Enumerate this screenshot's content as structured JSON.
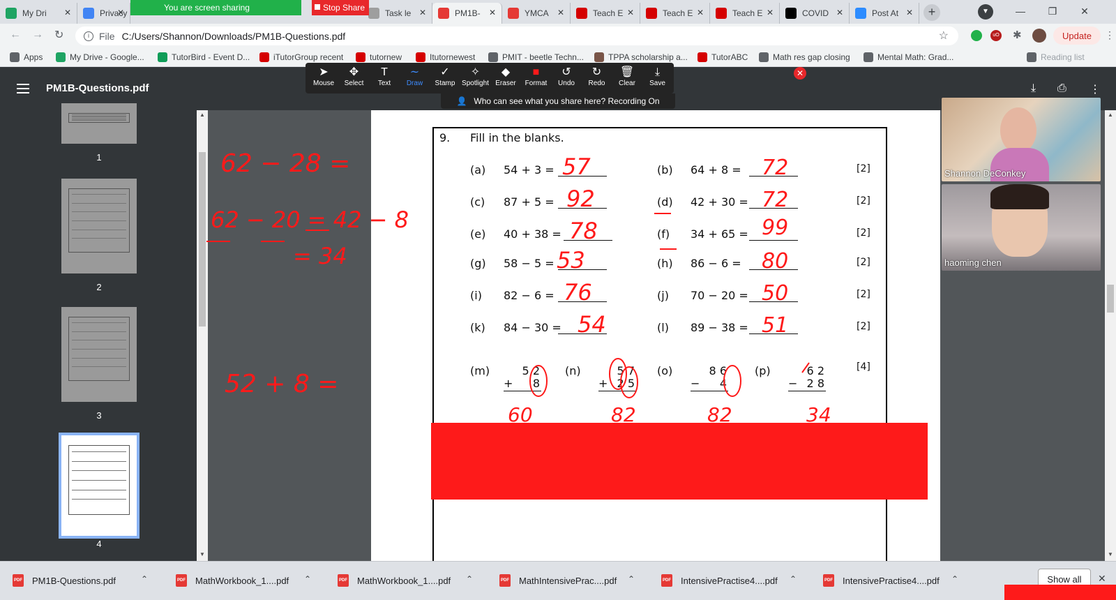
{
  "tabs": [
    {
      "label": "My Dri",
      "icon": "google-drive-icon",
      "color": "#1fa463"
    },
    {
      "label": "Privacy",
      "icon": "google-icon",
      "color": "#4285f4"
    },
    {
      "label": "Task le",
      "icon": "document-icon",
      "color": "#9e9e9e"
    },
    {
      "label": "PM1B-",
      "icon": "pdf-icon",
      "color": "#e53935",
      "active": true
    },
    {
      "label": "YMCA",
      "icon": "ymca-icon",
      "color": "#e53935"
    },
    {
      "label": "Teach E",
      "icon": "itutor-icon",
      "color": "#d50000"
    },
    {
      "label": "Teach E",
      "icon": "itutor-icon",
      "color": "#d50000"
    },
    {
      "label": "Teach E",
      "icon": "itutor-icon",
      "color": "#d50000"
    },
    {
      "label": "COVID",
      "icon": "covid-icon",
      "color": "#000000"
    },
    {
      "label": "Post At",
      "icon": "zoom-icon",
      "color": "#2d8cff"
    }
  ],
  "sharing": {
    "status": "You are screen sharing",
    "stop_label": "Stop Share"
  },
  "address": {
    "prefix": "File",
    "url": "C:/Users/Shannon/Downloads/PM1B-Questions.pdf",
    "update_label": "Update"
  },
  "bookmarks": [
    {
      "label": "Apps",
      "color": "#5f6368"
    },
    {
      "label": "My Drive - Google...",
      "color": "#1fa463"
    },
    {
      "label": "TutorBird - Event D...",
      "color": "#0f9d58"
    },
    {
      "label": "iTutorGroup recent",
      "color": "#d50000"
    },
    {
      "label": "tutornew",
      "color": "#d50000"
    },
    {
      "label": "Itutornewest",
      "color": "#d50000"
    },
    {
      "label": "PMIT - beetle Techn...",
      "color": "#5f6368"
    },
    {
      "label": "TPPA scholarship a...",
      "color": "#795548"
    },
    {
      "label": "TutorABC",
      "color": "#d50000"
    },
    {
      "label": "Math res gap closing",
      "color": "#5f6368"
    },
    {
      "label": "Mental Math: Grad...",
      "color": "#5f6368"
    },
    {
      "label": "Reading list",
      "color": "#5f6368"
    }
  ],
  "pdf": {
    "title": "PM1B-Questions.pdf"
  },
  "annotate_tools": [
    {
      "label": "Mouse",
      "icon": "cursor-icon",
      "glyph": "➤"
    },
    {
      "label": "Select",
      "icon": "move-icon",
      "glyph": "✥"
    },
    {
      "label": "Text",
      "icon": "text-icon",
      "glyph": "T"
    },
    {
      "label": "Draw",
      "icon": "draw-icon",
      "glyph": "∼",
      "selected": true
    },
    {
      "label": "Stamp",
      "icon": "stamp-icon",
      "glyph": "✓"
    },
    {
      "label": "Spotlight",
      "icon": "spotlight-icon",
      "glyph": "✧"
    },
    {
      "label": "Eraser",
      "icon": "eraser-icon",
      "glyph": "◆"
    },
    {
      "label": "Format",
      "icon": "format-icon",
      "glyph": "■"
    },
    {
      "label": "Undo",
      "icon": "undo-icon",
      "glyph": "↺"
    },
    {
      "label": "Redo",
      "icon": "redo-icon",
      "glyph": "↻"
    },
    {
      "label": "Clear",
      "icon": "trash-icon",
      "glyph": "🗑"
    },
    {
      "label": "Save",
      "icon": "save-icon",
      "glyph": "⤓"
    }
  ],
  "share_notice": "Who can see what you share here? Recording On",
  "thumbnails": [
    {
      "num": "1"
    },
    {
      "num": "2"
    },
    {
      "num": "3"
    },
    {
      "num": "4",
      "selected": true
    }
  ],
  "question": {
    "number": "9.",
    "prompt": "Fill in the blanks.",
    "rows": [
      {
        "left": {
          "label": "(a)",
          "expr": "54 + 3 =",
          "answer": "57"
        },
        "right": {
          "label": "(b)",
          "expr": "64 + 8 =",
          "answer": "72"
        },
        "marks": "[2]"
      },
      {
        "left": {
          "label": "(c)",
          "expr": "87 + 5 =",
          "answer": "92"
        },
        "right": {
          "label": "(d)",
          "expr": "42 + 30 =",
          "answer": "72"
        },
        "marks": "[2]"
      },
      {
        "left": {
          "label": "(e)",
          "expr": "40 + 38 =",
          "answer": "78"
        },
        "right": {
          "label": "(f)",
          "expr": "34 + 65 =",
          "answer": "99"
        },
        "marks": "[2]"
      },
      {
        "left": {
          "label": "(g)",
          "expr": "58 − 5 =",
          "answer": "53"
        },
        "right": {
          "label": "(h)",
          "expr": "86 − 6 =",
          "answer": "80"
        },
        "marks": "[2]"
      },
      {
        "left": {
          "label": "(i)",
          "expr": "82 − 6 =",
          "answer": "76"
        },
        "right": {
          "label": "(j)",
          "expr": "70 − 20 =",
          "answer": "50"
        },
        "marks": "[2]"
      },
      {
        "left": {
          "label": "(k)",
          "expr": "84 − 30 =",
          "answer": "54"
        },
        "right": {
          "label": "(l)",
          "expr": "89 − 38 =",
          "answer": "51"
        },
        "marks": "[2]"
      }
    ],
    "vertical": [
      {
        "label": "(m)",
        "top": "5 2",
        "op": "+",
        "bottom": "8",
        "answer": "60"
      },
      {
        "label": "(n)",
        "top": "5 7",
        "op": "+",
        "bottom": "2 5",
        "answer": "82"
      },
      {
        "label": "(o)",
        "top": "8 6",
        "op": "−",
        "bottom": "4",
        "answer": "82"
      },
      {
        "label": "(p)",
        "top": "6 2",
        "op": "−",
        "bottom": "2 8",
        "answer": "34"
      }
    ],
    "vertical_marks": "[4]"
  },
  "scratch": {
    "line1": "62 − 28 =",
    "line2": "62 − 20 = 42 − 8",
    "line3": "= 34",
    "line4": "52 + 8 ="
  },
  "participants": [
    {
      "name": "Shannon DeConkey"
    },
    {
      "name": "haoming   chen"
    }
  ],
  "downloads": [
    {
      "label": "PM1B-Questions.pdf"
    },
    {
      "label": "MathWorkbook_1....pdf"
    },
    {
      "label": "MathWorkbook_1....pdf"
    },
    {
      "label": "MathIntensivePrac....pdf"
    },
    {
      "label": "IntensivePractise4....pdf"
    },
    {
      "label": "IntensivePractise4....pdf"
    }
  ],
  "show_all_label": "Show all",
  "colors": {
    "ink": "#fe1a1a",
    "zoom_green": "#21b14a",
    "stop_red": "#e8282b",
    "toolbar_selected": "#3d8bfd"
  }
}
